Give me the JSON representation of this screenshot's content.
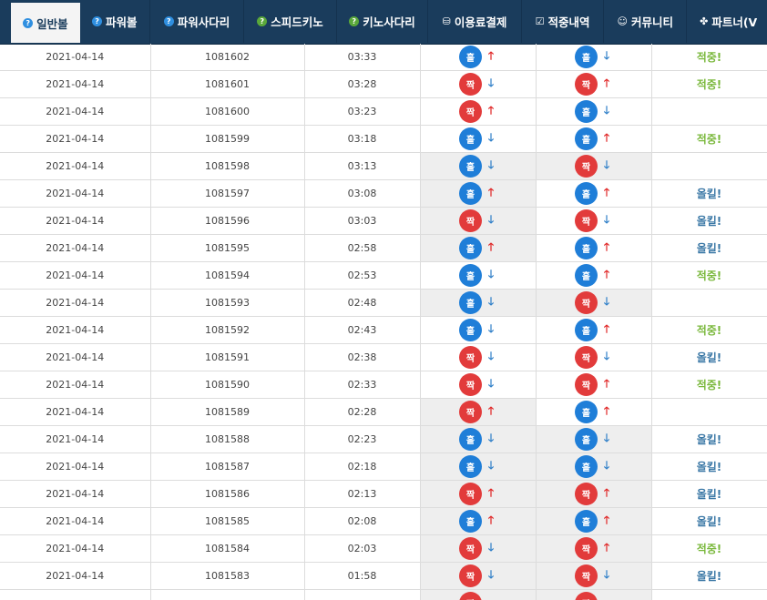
{
  "nav": {
    "items": [
      {
        "label": "일반볼",
        "icon": "question-icon",
        "active": true
      },
      {
        "label": "파워볼",
        "icon": "question-icon"
      },
      {
        "label": "파워사다리",
        "icon": "question-icon"
      },
      {
        "label": "스피드키노",
        "icon": "question-green-icon"
      },
      {
        "label": "키노사다리",
        "icon": "question-green-icon"
      },
      {
        "label": "이용료결제",
        "icon": "database-icon"
      },
      {
        "label": "적중내역",
        "icon": "checkbox-icon"
      },
      {
        "label": "커뮤니티",
        "icon": "smile-icon"
      },
      {
        "label": "파트너(V",
        "icon": "partner-icon"
      }
    ]
  },
  "ball_labels": {
    "odd": "홀",
    "even": "짝"
  },
  "result_labels": {
    "hit": "적중!",
    "miss": "올킬!"
  },
  "colors": {
    "nav_bg": "#1a3c5c",
    "odd_ball": "#1f7ed8",
    "even_ball": "#e23b3b",
    "arrow_up": "#e02424",
    "arrow_down": "#2f7fc8",
    "hit": "#7ab83c",
    "miss": "#3b78a6"
  },
  "rows": [
    {
      "date": "2021-04-14",
      "round": "1081602",
      "time": "03:33",
      "a_ball": "홀",
      "a_arrow": "up",
      "b_ball": "홀",
      "b_arrow": "down",
      "result": "적중!"
    },
    {
      "date": "2021-04-14",
      "round": "1081601",
      "time": "03:28",
      "a_ball": "짝",
      "a_arrow": "down",
      "b_ball": "짝",
      "b_arrow": "up",
      "result": "적중!"
    },
    {
      "date": "2021-04-14",
      "round": "1081600",
      "time": "03:23",
      "a_ball": "짝",
      "a_arrow": "up",
      "b_ball": "홀",
      "b_arrow": "down",
      "result": ""
    },
    {
      "date": "2021-04-14",
      "round": "1081599",
      "time": "03:18",
      "a_ball": "홀",
      "a_arrow": "down",
      "b_ball": "홀",
      "b_arrow": "up",
      "result": "적중!"
    },
    {
      "date": "2021-04-14",
      "round": "1081598",
      "time": "03:13",
      "a_ball": "홀",
      "a_arrow": "down",
      "b_ball": "짝",
      "b_arrow": "down",
      "result": ""
    },
    {
      "date": "2021-04-14",
      "round": "1081597",
      "time": "03:08",
      "a_ball": "홀",
      "a_arrow": "up",
      "b_ball": "홀",
      "b_arrow": "up",
      "result": "올킬!"
    },
    {
      "date": "2021-04-14",
      "round": "1081596",
      "time": "03:03",
      "a_ball": "짝",
      "a_arrow": "down",
      "b_ball": "짝",
      "b_arrow": "down",
      "result": "올킬!"
    },
    {
      "date": "2021-04-14",
      "round": "1081595",
      "time": "02:58",
      "a_ball": "홀",
      "a_arrow": "up",
      "b_ball": "홀",
      "b_arrow": "up",
      "result": "올킬!"
    },
    {
      "date": "2021-04-14",
      "round": "1081594",
      "time": "02:53",
      "a_ball": "홀",
      "a_arrow": "down",
      "b_ball": "홀",
      "b_arrow": "up",
      "result": "적중!"
    },
    {
      "date": "2021-04-14",
      "round": "1081593",
      "time": "02:48",
      "a_ball": "홀",
      "a_arrow": "down",
      "b_ball": "짝",
      "b_arrow": "down",
      "result": ""
    },
    {
      "date": "2021-04-14",
      "round": "1081592",
      "time": "02:43",
      "a_ball": "홀",
      "a_arrow": "down",
      "b_ball": "홀",
      "b_arrow": "up",
      "result": "적중!"
    },
    {
      "date": "2021-04-14",
      "round": "1081591",
      "time": "02:38",
      "a_ball": "짝",
      "a_arrow": "down",
      "b_ball": "짝",
      "b_arrow": "down",
      "result": "올킬!"
    },
    {
      "date": "2021-04-14",
      "round": "1081590",
      "time": "02:33",
      "a_ball": "짝",
      "a_arrow": "down",
      "b_ball": "짝",
      "b_arrow": "up",
      "result": "적중!"
    },
    {
      "date": "2021-04-14",
      "round": "1081589",
      "time": "02:28",
      "a_ball": "짝",
      "a_arrow": "up",
      "b_ball": "홀",
      "b_arrow": "up",
      "result": ""
    },
    {
      "date": "2021-04-14",
      "round": "1081588",
      "time": "02:23",
      "a_ball": "홀",
      "a_arrow": "down",
      "b_ball": "홀",
      "b_arrow": "down",
      "result": "올킬!"
    },
    {
      "date": "2021-04-14",
      "round": "1081587",
      "time": "02:18",
      "a_ball": "홀",
      "a_arrow": "down",
      "b_ball": "홀",
      "b_arrow": "down",
      "result": "올킬!"
    },
    {
      "date": "2021-04-14",
      "round": "1081586",
      "time": "02:13",
      "a_ball": "짝",
      "a_arrow": "up",
      "b_ball": "짝",
      "b_arrow": "up",
      "result": "올킬!"
    },
    {
      "date": "2021-04-14",
      "round": "1081585",
      "time": "02:08",
      "a_ball": "홀",
      "a_arrow": "up",
      "b_ball": "홀",
      "b_arrow": "up",
      "result": "올킬!"
    },
    {
      "date": "2021-04-14",
      "round": "1081584",
      "time": "02:03",
      "a_ball": "짝",
      "a_arrow": "down",
      "b_ball": "짝",
      "b_arrow": "up",
      "result": "적중!"
    },
    {
      "date": "2021-04-14",
      "round": "1081583",
      "time": "01:58",
      "a_ball": "짝",
      "a_arrow": "down",
      "b_ball": "짝",
      "b_arrow": "down",
      "result": "올킬!"
    },
    {
      "date": "",
      "round": "",
      "time": "",
      "a_ball": "짝",
      "a_arrow": "",
      "b_ball": "짝",
      "b_arrow": "",
      "result": ""
    }
  ]
}
